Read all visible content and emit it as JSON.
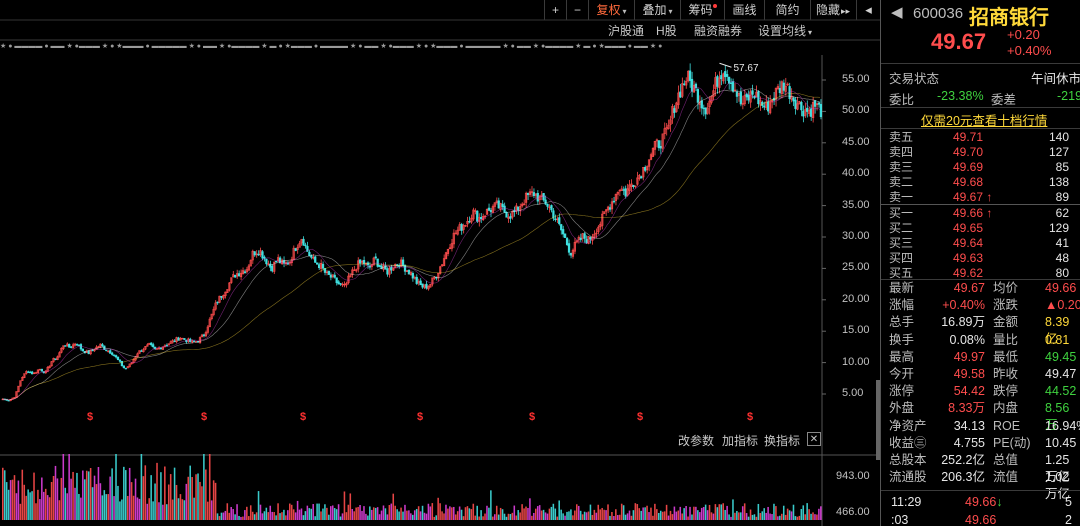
{
  "toolbar": {
    "plus": "+",
    "minus": "−",
    "fq": "复权",
    "overlay": "叠加",
    "chips": "筹码",
    "draw": "画线",
    "brief": "简约",
    "hide": "隐藏",
    "more": "▸▸"
  },
  "subbar": {
    "hsgt": "沪股通",
    "h": "H股",
    "margin": "融资融券",
    "ma": "设置均线"
  },
  "cash_marker": "$",
  "indicator": {
    "change": "改参数",
    "add": "加指标",
    "swap": "换指标",
    "close": "✕"
  },
  "chart_data": [
    {
      "type": "candlestick",
      "title": "",
      "yticks": [
        5,
        10,
        15,
        20,
        25,
        30,
        35,
        40,
        45,
        50,
        55
      ],
      "ytick_labels": [
        "5.00",
        "10.00",
        "15.00",
        "20.00",
        "25.00",
        "30.00",
        "35.00",
        "40.00",
        "45.00",
        "50.00",
        "55.00"
      ],
      "ylim": [
        0,
        60
      ],
      "annotation": {
        "label": "57.67",
        "value": 57.67
      },
      "dividend_markers": 7,
      "price_path": [
        4.2,
        4.0,
        4.6,
        7.5,
        8.7,
        8.2,
        9.0,
        8.4,
        10.2,
        11.0,
        13.0,
        12.4,
        13.2,
        12.0,
        11.5,
        12.2,
        12.8,
        12.0,
        11.5,
        10.2,
        9.0,
        9.8,
        11.5,
        12.2,
        12.8,
        12.0,
        12.5,
        13.0,
        13.4,
        14.0,
        13.6,
        13.2,
        13.5,
        14.5,
        17.0,
        19.5,
        21.0,
        22.5,
        24.0,
        24.5,
        25.0,
        27.5,
        28.0,
        26.5,
        25.0,
        26.5,
        25.5,
        26.2,
        28.5,
        30.0,
        27.5,
        26.0,
        25.5,
        24.0,
        23.5,
        22.5,
        22.0,
        24.0,
        25.5,
        26.0,
        25.0,
        26.5,
        25.0,
        24.5,
        25.5,
        26.0,
        25.0,
        24.0,
        22.5,
        22.0,
        22.5,
        24.0,
        26.0,
        28.5,
        30.5,
        31.5,
        32.5,
        34.0,
        33.0,
        33.8,
        34.5,
        35.0,
        34.2,
        33.5,
        34.0,
        35.5,
        36.5,
        37.0,
        36.0,
        35.5,
        34.0,
        32.0,
        30.0,
        27.5,
        29.0,
        30.0,
        29.5,
        31.0,
        32.5,
        34.5,
        36.0,
        38.0,
        37.0,
        38.5,
        39.5,
        41.0,
        43.0,
        44.5,
        45.5,
        47.0,
        51.0,
        53.5,
        55.5,
        54.0,
        52.5,
        50.5,
        52.0,
        55.0,
        57.0,
        55.5,
        53.5,
        51.0,
        52.0,
        53.0,
        51.5,
        50.5,
        52.0,
        53.5,
        54.5,
        53.0,
        51.5,
        50.5,
        50.0,
        51.0,
        50.2
      ],
      "volume_ticks": [
        "943.00",
        "466.00"
      ]
    }
  ],
  "quote": {
    "code": "600036",
    "name": "招商银行",
    "last": "49.67",
    "chg": "+0.20",
    "chg_pct": "+0.40%",
    "status_label": "交易状态",
    "status_value": "午间休市",
    "wb_label": "委比",
    "wb_value": "-23.38%",
    "wc_label": "委差",
    "wc_value": "-219",
    "link": "仅需20元查看十档行情",
    "asks": [
      {
        "label": "卖五",
        "price": "49.71",
        "vol": "140",
        "arrow": ""
      },
      {
        "label": "卖四",
        "price": "49.70",
        "vol": "127",
        "arrow": ""
      },
      {
        "label": "卖三",
        "price": "49.69",
        "vol": "85",
        "arrow": ""
      },
      {
        "label": "卖二",
        "price": "49.68",
        "vol": "138",
        "arrow": ""
      },
      {
        "label": "卖一",
        "price": "49.67",
        "vol": "89",
        "arrow": "↑"
      }
    ],
    "bids": [
      {
        "label": "买一",
        "price": "49.66",
        "vol": "62",
        "arrow": "↑"
      },
      {
        "label": "买二",
        "price": "49.65",
        "vol": "129",
        "arrow": ""
      },
      {
        "label": "买三",
        "price": "49.64",
        "vol": "41",
        "arrow": ""
      },
      {
        "label": "买四",
        "price": "49.63",
        "vol": "48",
        "arrow": ""
      },
      {
        "label": "买五",
        "price": "49.62",
        "vol": "80",
        "arrow": ""
      }
    ],
    "stats": [
      {
        "l1": "最新",
        "v1": "49.67",
        "c1": "red",
        "l2": "均价",
        "v2": "49.66",
        "c2": "red"
      },
      {
        "l1": "涨幅",
        "v1": "+0.40%",
        "c1": "red",
        "l2": "涨跌",
        "v2": "▲0.20",
        "c2": "red"
      },
      {
        "l1": "总手",
        "v1": "16.89万",
        "c1": "white",
        "l2": "金额",
        "v2": "8.39亿",
        "c2": "yellow"
      },
      {
        "l1": "换手",
        "v1": "0.08%",
        "c1": "white",
        "l2": "量比",
        "v2": "0.81",
        "c2": "yellow"
      },
      {
        "l1": "最高",
        "v1": "49.97",
        "c1": "red",
        "l2": "最低",
        "v2": "49.45",
        "c2": "green"
      },
      {
        "l1": "今开",
        "v1": "49.58",
        "c1": "red",
        "l2": "昨收",
        "v2": "49.47",
        "c2": "white"
      },
      {
        "l1": "涨停",
        "v1": "54.42",
        "c1": "red",
        "l2": "跌停",
        "v2": "44.52",
        "c2": "green"
      },
      {
        "l1": "外盘",
        "v1": "8.33万",
        "c1": "red",
        "l2": "内盘",
        "v2": "8.56万",
        "c2": "green"
      },
      {
        "l1": "净资产",
        "v1": "34.13",
        "c1": "white",
        "l2": "ROE",
        "v2": "16.94%",
        "c2": "white"
      },
      {
        "l1": "收益㊂",
        "v1": "4.755",
        "c1": "white",
        "l2": "PE(动)",
        "v2": "10.45",
        "c2": "white"
      },
      {
        "l1": "总股本",
        "v1": "252.2亿",
        "c1": "white",
        "l2": "总值",
        "v2": "1.25万亿",
        "c2": "white"
      },
      {
        "l1": "流通股",
        "v1": "206.3亿",
        "c1": "white",
        "l2": "流值",
        "v2": "1.02万亿",
        "c2": "white"
      }
    ],
    "ticks": [
      {
        "time": "11:29",
        "price": "49.66",
        "arrow": "↓",
        "vol": "5"
      },
      {
        "time": ":03",
        "price": "49.66",
        "arrow": "",
        "vol": "2"
      }
    ]
  },
  "colors": {
    "up": "#ff4d4d",
    "down": "#3fe0e0",
    "bg": "#000000",
    "yellow": "#ffd93a",
    "green": "#3fd23f"
  }
}
